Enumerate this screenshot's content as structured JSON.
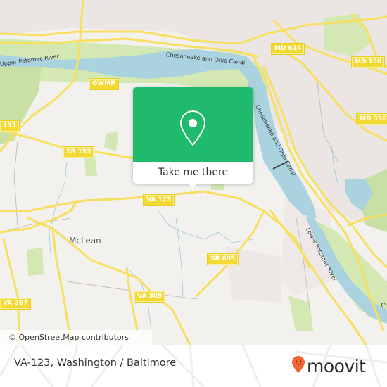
{
  "map": {
    "road_shields": [
      {
        "id": "md-614",
        "label": "MD 614"
      },
      {
        "id": "md-190",
        "label": "MD 190"
      },
      {
        "id": "md-396",
        "label": "MD 396"
      },
      {
        "id": "gwmp",
        "label": "GWMP"
      },
      {
        "id": "sr-193-left",
        "label": "193"
      },
      {
        "id": "sr-193",
        "label": "SR 193"
      },
      {
        "id": "va-123",
        "label": "VA 123"
      },
      {
        "id": "sr-695",
        "label": "SR 695"
      },
      {
        "id": "va-309",
        "label": "VA 309"
      },
      {
        "id": "va-267",
        "label": "VA 267"
      }
    ],
    "labels": {
      "upper_potomac": "Upper Potomac River",
      "chesapeake_canal_top": "Chesapeake and Ohio Canal",
      "chesapeake_canal_side": "Chesapeake and Ohio Canal",
      "lower_potomac": "Lower Potomac River",
      "mclean": "McLean",
      "edge_label": "C"
    },
    "attribution": "© OpenStreetMap contributors",
    "colors": {
      "land": "#f2f1ee",
      "water": "#aad3df",
      "park": "#d4e8b4",
      "road": "#f7df5f",
      "urban": "#ebe5e3"
    }
  },
  "popup": {
    "icon": "map-pin-icon",
    "cta_label": "Take me there",
    "accent": "#1fba6b"
  },
  "footer": {
    "location_title": "VA-123, Washington / Baltimore",
    "brand_name": "moovit",
    "brand_color": "#f26530"
  }
}
